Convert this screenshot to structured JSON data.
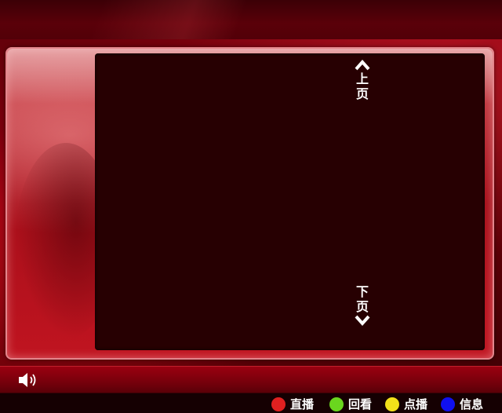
{
  "pager": {
    "up": [
      "上",
      "页"
    ],
    "down": [
      "下",
      "页"
    ]
  },
  "status": {
    "volume_icon": "speaker-icon"
  },
  "legend": [
    {
      "key": "red",
      "color": "#e02020",
      "label": "直播"
    },
    {
      "key": "green",
      "color": "#6ad61e",
      "label": "回看"
    },
    {
      "key": "yellow",
      "color": "#f2e01a",
      "label": "点播"
    },
    {
      "key": "blue",
      "color": "#1010f0",
      "label": "信息"
    }
  ],
  "colors": {
    "theme_red": "#a80f1a",
    "content_bg": "#270002"
  }
}
